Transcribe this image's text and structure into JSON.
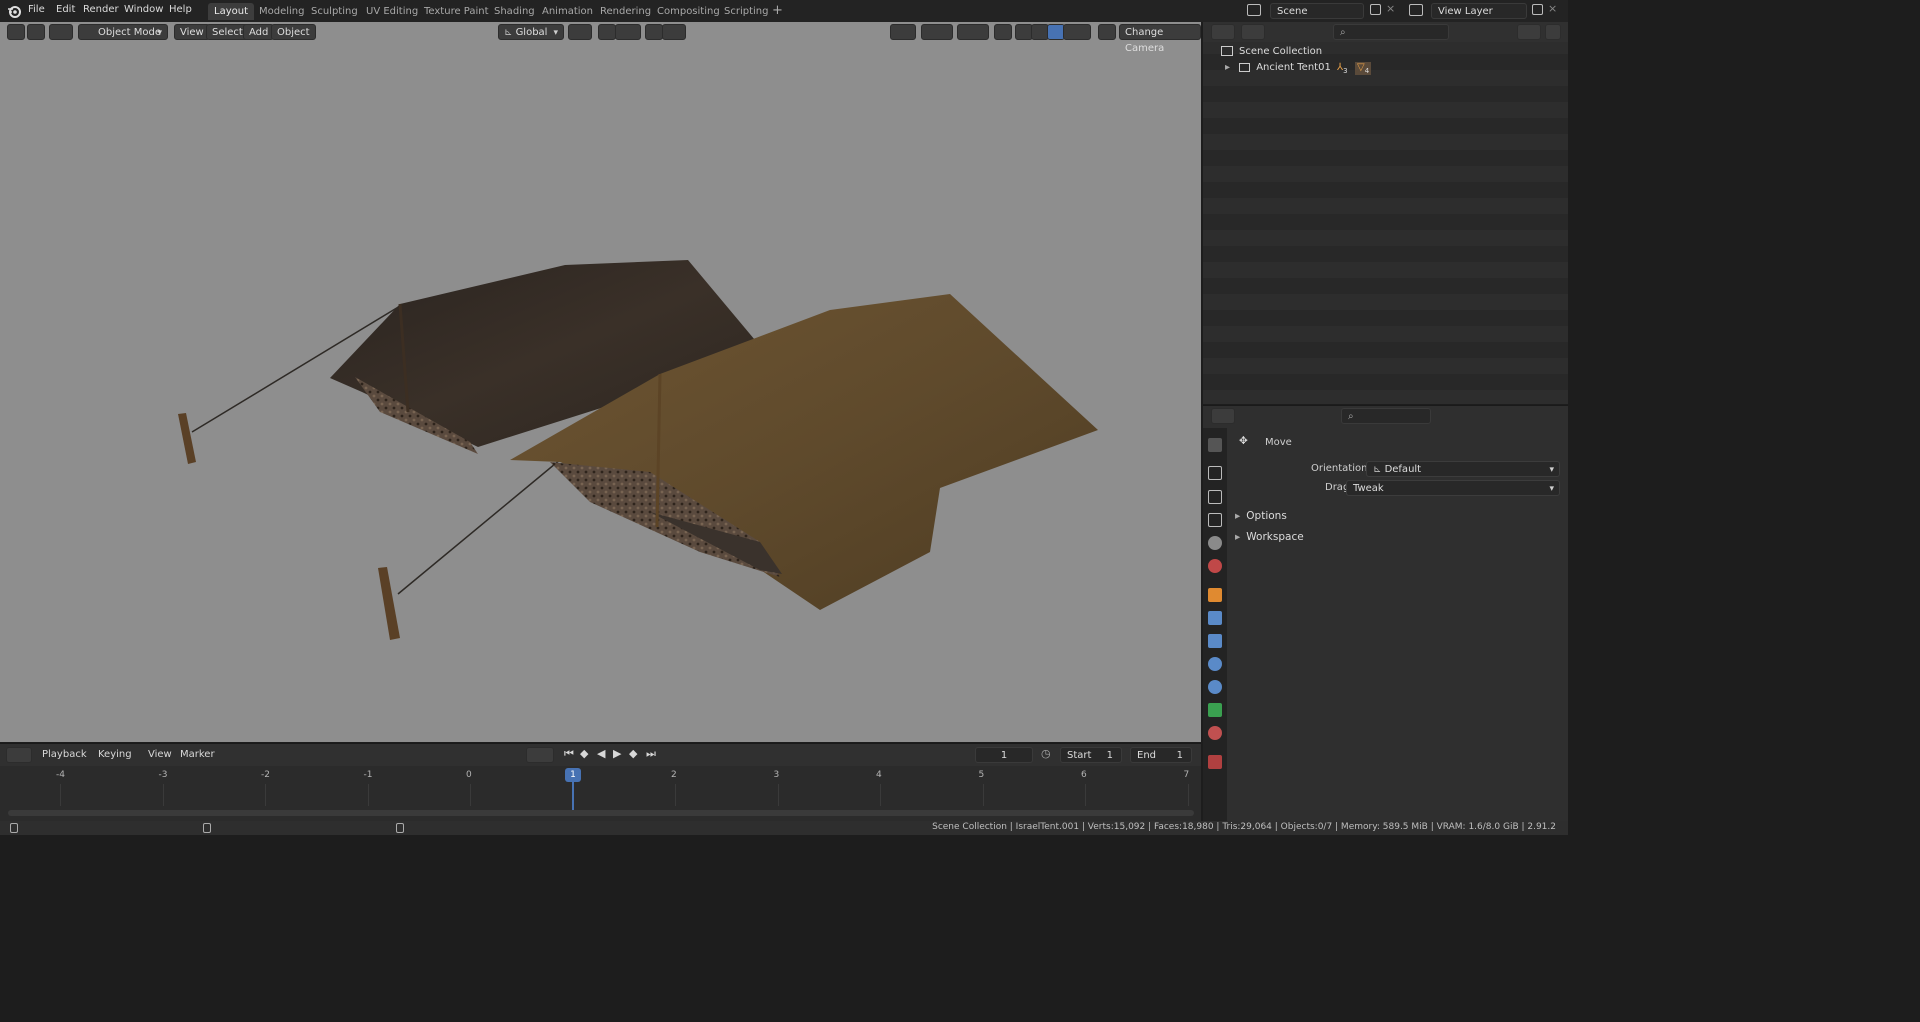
{
  "menu": [
    "File",
    "Edit",
    "Render",
    "Window",
    "Help"
  ],
  "workspaces": [
    "Layout",
    "Modeling",
    "Sculpting",
    "UV Editing",
    "Texture Paint",
    "Shading",
    "Animation",
    "Rendering",
    "Compositing",
    "Scripting"
  ],
  "active_workspace": "Layout",
  "scene_name": "Scene",
  "view_layer": "View Layer",
  "viewport": {
    "mode": "Object Mode",
    "menus": [
      "View",
      "Select",
      "Add",
      "Object"
    ],
    "orientation": "Global",
    "camera_button": "Change Camera"
  },
  "outliner": {
    "root": "Scene Collection",
    "items": [
      {
        "label": "Ancient Tent01",
        "badges": [
          "3",
          "4"
        ]
      }
    ],
    "search_placeholder": ""
  },
  "properties": {
    "tool_name": "Move",
    "orientation_label": "Orientation",
    "orientation_value": "Default",
    "drag_label": "Drag:",
    "drag_value": "Tweak",
    "panels": [
      "Options",
      "Workspace"
    ]
  },
  "timeline": {
    "menus": [
      "Playback",
      "Keying",
      "View",
      "Marker"
    ],
    "current_frame": "1",
    "start_label": "Start",
    "start_value": "1",
    "end_label": "End",
    "end_value": "1",
    "ruler": [
      "-4",
      "-3",
      "-2",
      "-1",
      "0",
      "1",
      "2",
      "3",
      "4",
      "5",
      "6",
      "7"
    ]
  },
  "status": "Scene Collection | IsraelTent.001 | Verts:15,092 | Faces:18,980 | Tris:29,064 | Objects:0/7 | Memory: 589.5 MiB | VRAM: 1.6/8.0 GiB | 2.91.2",
  "colors": {
    "accent": "#4772b3",
    "viewport_bg": "#8e8e8e"
  }
}
